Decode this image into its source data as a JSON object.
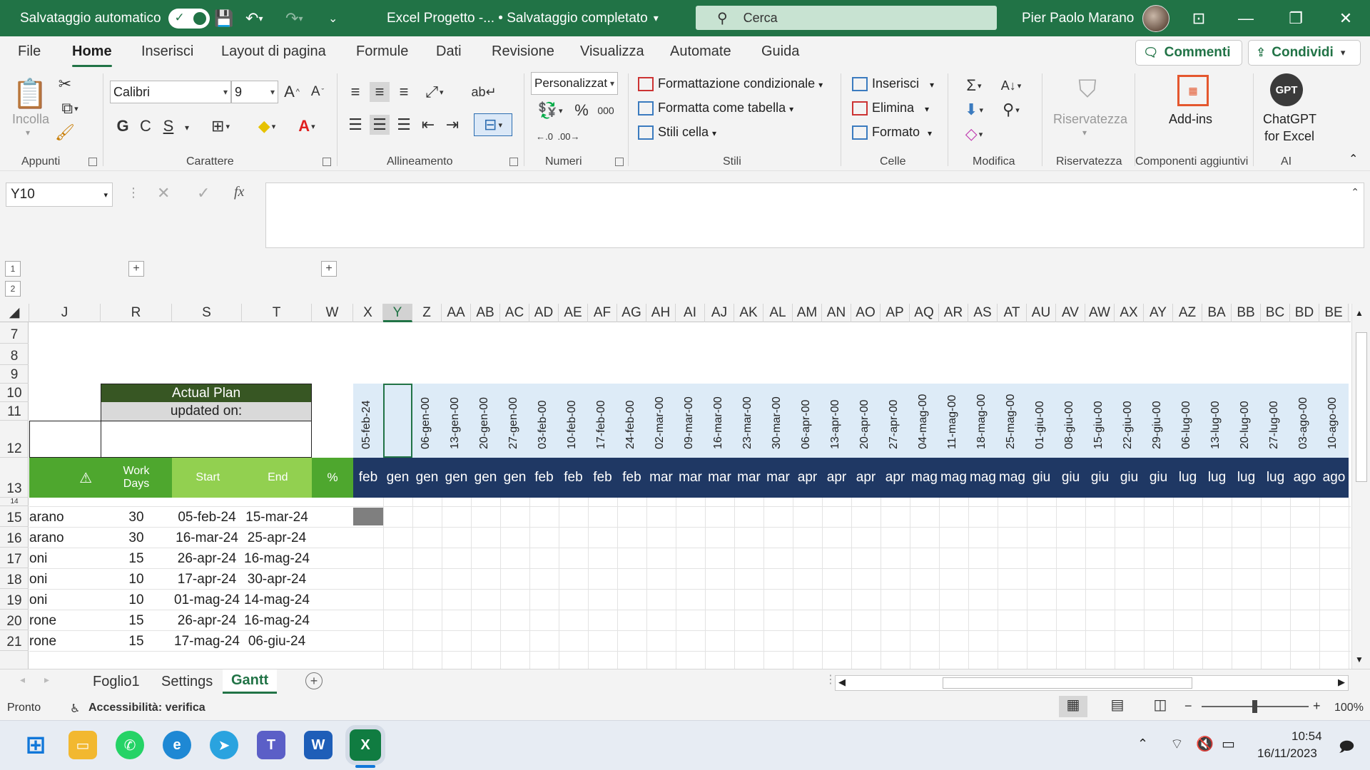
{
  "titlebar": {
    "autosave_label": "Salvataggio automatico",
    "doc_title": "Excel Progetto  -...  • Salvataggio completato",
    "search_placeholder": "Cerca",
    "user_name": "Pier Paolo Marano"
  },
  "menu": {
    "tabs": [
      "File",
      "Home",
      "Inserisci",
      "Layout di pagina",
      "Formule",
      "Dati",
      "Revisione",
      "Visualizza",
      "Automate",
      "Guida"
    ],
    "active": "Home",
    "comments_label": "Commenti",
    "share_label": "Condividi"
  },
  "ribbon": {
    "paste_label": "Incolla",
    "font_name": "Calibri",
    "font_size": "9",
    "number_format": "Personalizzat",
    "bold": "G",
    "italic": "C",
    "underline": "S",
    "thousands": "000",
    "cond_format": "Formattazione condizionale",
    "format_table": "Formatta come tabella",
    "cell_styles": "Stili cella",
    "insert": "Inserisci",
    "delete": "Elimina",
    "format": "Formato",
    "privacy": "Riservatezza",
    "addins": "Add-ins",
    "chatgpt_line1": "ChatGPT",
    "chatgpt_line2": "for Excel",
    "gpt_logo": "GPT",
    "groups": {
      "clipboard": "Appunti",
      "font": "Carattere",
      "alignment": "Allineamento",
      "numbers": "Numeri",
      "styles": "Stili",
      "cells": "Celle",
      "editing": "Modifica",
      "privacy": "Riservatezza",
      "addins": "Componenti aggiuntivi",
      "ai": "AI"
    }
  },
  "formula_bar": {
    "name_box": "Y10",
    "fx": "fx",
    "value": ""
  },
  "outline": {
    "levels": [
      "1",
      "2"
    ],
    "expand": "+"
  },
  "columns": [
    "J",
    "R",
    "S",
    "T",
    "W",
    "X",
    "Y",
    "Z",
    "AA",
    "AB",
    "AC",
    "AD",
    "AE",
    "AF",
    "AG",
    "AH",
    "AI",
    "AJ",
    "AK",
    "AL",
    "AM",
    "AN",
    "AO",
    "AP",
    "AQ",
    "AR",
    "AS",
    "AT",
    "AU",
    "AV",
    "AW",
    "AX",
    "AY",
    "AZ",
    "BA",
    "BB",
    "BC",
    "BD",
    "BE"
  ],
  "selected_column": "Y",
  "rows": [
    "7",
    "8",
    "9",
    "10",
    "11",
    "12",
    "13",
    "15",
    "16",
    "17",
    "18",
    "19",
    "20",
    "21"
  ],
  "plan": {
    "title": "Actual Plan",
    "updated": "updated on:"
  },
  "headers": {
    "warn_icon": "⚠",
    "work_days_1": "Work",
    "work_days_2": "Days",
    "start": "Start",
    "end": "End",
    "pct": "%"
  },
  "timeline_dates": [
    "05-feb-24",
    "",
    "06-gen-00",
    "13-gen-00",
    "20-gen-00",
    "27-gen-00",
    "03-feb-00",
    "10-feb-00",
    "17-feb-00",
    "24-feb-00",
    "02-mar-00",
    "09-mar-00",
    "16-mar-00",
    "23-mar-00",
    "30-mar-00",
    "06-apr-00",
    "13-apr-00",
    "20-apr-00",
    "27-apr-00",
    "04-mag-00",
    "11-mag-00",
    "18-mag-00",
    "25-mag-00",
    "01-giu-00",
    "08-giu-00",
    "15-giu-00",
    "22-giu-00",
    "29-giu-00",
    "06-lug-00",
    "13-lug-00",
    "20-lug-00",
    "27-lug-00",
    "03-ago-00",
    "10-ago-00"
  ],
  "timeline_months": [
    "feb",
    "gen",
    "gen",
    "gen",
    "gen",
    "gen",
    "feb",
    "feb",
    "feb",
    "feb",
    "mar",
    "mar",
    "mar",
    "mar",
    "mar",
    "apr",
    "apr",
    "apr",
    "apr",
    "mag",
    "mag",
    "mag",
    "mag",
    "giu",
    "giu",
    "giu",
    "giu",
    "giu",
    "lug",
    "lug",
    "lug",
    "lug",
    "ago",
    "ago"
  ],
  "tasks": [
    {
      "row": "15",
      "name": "arano",
      "days": "30",
      "start": "05-feb-24",
      "end": "15-mar-24"
    },
    {
      "row": "16",
      "name": "arano",
      "days": "30",
      "start": "16-mar-24",
      "end": "25-apr-24"
    },
    {
      "row": "17",
      "name": "oni",
      "days": "15",
      "start": "26-apr-24",
      "end": "16-mag-24"
    },
    {
      "row": "18",
      "name": "oni",
      "days": "10",
      "start": "17-apr-24",
      "end": "30-apr-24"
    },
    {
      "row": "19",
      "name": "oni",
      "days": "10",
      "start": "01-mag-24",
      "end": "14-mag-24"
    },
    {
      "row": "20",
      "name": "rone",
      "days": "15",
      "start": "26-apr-24",
      "end": "16-mag-24"
    },
    {
      "row": "21",
      "name": "rone",
      "days": "15",
      "start": "17-mag-24",
      "end": "06-giu-24"
    }
  ],
  "sheet_tabs": [
    "Foglio1",
    "Settings",
    "Gantt"
  ],
  "active_sheet": "Gantt",
  "status": {
    "ready": "Pronto",
    "accessibility": "Accessibilità: verifica",
    "zoom": "100%"
  },
  "taskbar": {
    "time": "10:54",
    "date": "16/11/2023"
  },
  "colors": {
    "excel_green": "#217346",
    "dark_green": "#375623",
    "light_green": "#92d050",
    "green": "#4ea72e",
    "navy": "#1f3864",
    "light_blue": "#ddebf7"
  }
}
